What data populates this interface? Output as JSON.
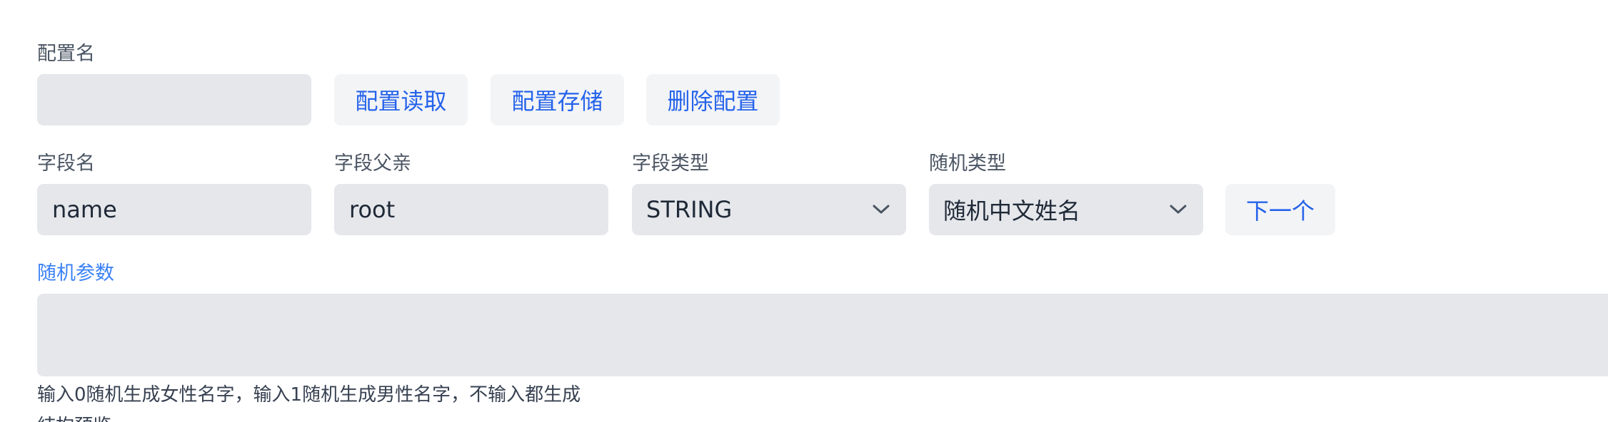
{
  "config": {
    "name_label": "配置名",
    "name_value": "",
    "read_button": "配置读取",
    "save_button": "配置存储",
    "delete_button": "删除配置"
  },
  "field": {
    "name_label": "字段名",
    "name_value": "name",
    "parent_label": "字段父亲",
    "parent_value": "root",
    "type_label": "字段类型",
    "type_value": "STRING",
    "random_type_label": "随机类型",
    "random_type_value": "随机中文姓名",
    "next_button": "下一个"
  },
  "random_params": {
    "label": "随机参数",
    "value": "",
    "hint": "输入0随机生成女性名字，输入1随机生成男性名字，不输入都生成",
    "next_line_partial": "結构预览"
  },
  "icons": {
    "type_select_caret": "chevron-down-icon",
    "random_type_select_caret": "chevron-down-icon"
  },
  "colors": {
    "accent": "#2563eb",
    "label_accent": "#3b82f6",
    "field_bg": "#e5e7eb",
    "button_bg": "#f3f4f6"
  }
}
